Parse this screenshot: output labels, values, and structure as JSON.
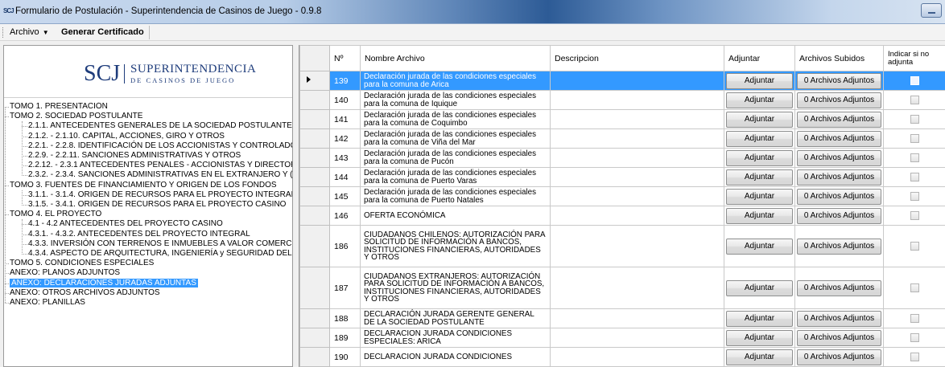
{
  "window": {
    "icon_text": "SCJ",
    "title": "Formulario de Postulación - Superintendencia de Casinos de Juego - 0.9.8"
  },
  "menu": {
    "archivo": "Archivo",
    "generar": "Generar Certificado"
  },
  "logo": {
    "mark": "SCJ",
    "line1": "SUPERINTENDENCIA",
    "line2": "DE CASINOS DE JUEGO"
  },
  "tree": [
    {
      "label": "TOMO 1.  PRESENTACIÓN",
      "level": 0,
      "selected": false
    },
    {
      "label": "TOMO 2.  SOCIEDAD POSTULANTE",
      "level": 0,
      "selected": false
    },
    {
      "label": "2.1.1. ANTECEDENTES GENERALES DE LA SOCIEDAD POSTULANTE",
      "level": 1,
      "selected": false
    },
    {
      "label": "2.1.2. - 2.1.10. CAPITAL, ACCIONES, GIRO Y OTROS",
      "level": 1,
      "selected": false
    },
    {
      "label": "2.2.1. - 2.2.8. IDENTIFICACIÓN DE LOS ACCIONISTAS Y CONTROLADO",
      "level": 1,
      "selected": false
    },
    {
      "label": "2.2.9. - 2.2.11. SANCIONES ADMINISTRATIVAS Y OTROS",
      "level": 1,
      "selected": false
    },
    {
      "label": "2.2.12. - 2.3.1 ANTECEDENTES PENALES - ACCIONISTAS Y DIRECTOR",
      "level": 1,
      "selected": false
    },
    {
      "label": "2.3.2. - 2.3.4. SANCIONES ADMINISTRATIVAS EN EL EXTRANJERO Y (",
      "level": 1,
      "selected": false
    },
    {
      "label": "TOMO 3.  FUENTES DE FINANCIAMIENTO Y ORIGEN DE LOS FONDOS",
      "level": 0,
      "selected": false
    },
    {
      "label": "3.1.1. - 3.1.4. ORIGEN DE RECURSOS PARA EL PROYECTO INTEGRAL",
      "level": 1,
      "selected": false
    },
    {
      "label": "3.1.5. - 3.4.1. ORIGEN DE RECURSOS PARA EL PROYECTO CASINO",
      "level": 1,
      "selected": false
    },
    {
      "label": "TOMO 4.  EL PROYECTO",
      "level": 0,
      "selected": false
    },
    {
      "label": "4.1 - 4.2  ANTECEDENTES DEL PROYECTO CASINO",
      "level": 1,
      "selected": false
    },
    {
      "label": "4.3.1. - 4.3.2. ANTECEDENTES DEL PROYECTO INTEGRAL",
      "level": 1,
      "selected": false
    },
    {
      "label": "4.3.3. INVERSIÓN CON TERRENOS E INMUEBLES A VALOR COMERCI",
      "level": 1,
      "selected": false
    },
    {
      "label": "4.3.4. ASPECTO DE ARQUITECTURA, INGENIERÍA y SEGURIDAD DEL",
      "level": 1,
      "selected": false
    },
    {
      "label": "TOMO 5.  CONDICIONES ESPECIALES",
      "level": 0,
      "selected": false
    },
    {
      "label": "ANEXO: PLANOS ADJUNTOS",
      "level": 0,
      "selected": false
    },
    {
      "label": "ANEXO: DECLARACIONES JURADAS ADJUNTAS",
      "level": 0,
      "selected": true
    },
    {
      "label": "ANEXO: OTROS ARCHIVOS ADJUNTOS",
      "level": 0,
      "selected": false
    },
    {
      "label": "ANEXO: PLANILLAS",
      "level": 0,
      "selected": false
    }
  ],
  "grid": {
    "headers": {
      "num": "Nº",
      "name": "Nombre Archivo",
      "desc": "Descripcion",
      "adjuntar": "Adjuntar",
      "subidos": "Archivos Subidos",
      "indicar": "Indicar si no adjunta"
    },
    "button_label": "Adjuntar",
    "rows": [
      {
        "num": "139",
        "name": "Declaración jurada de las condiciones especiales para la comuna de Arica",
        "desc": "",
        "files": "0 Archivos Adjuntos",
        "selected": true
      },
      {
        "num": "140",
        "name": "Declaración jurada de las condiciones especiales para la comuna de Iquique",
        "desc": "",
        "files": "0 Archivos Adjuntos",
        "selected": false
      },
      {
        "num": "141",
        "name": "Declaración jurada de las condiciones especiales para la comuna de Coquimbo",
        "desc": "",
        "files": "0 Archivos Adjuntos",
        "selected": false
      },
      {
        "num": "142",
        "name": "Declaración jurada de las condiciones especiales para la comuna de Viña del Mar",
        "desc": "",
        "files": "0 Archivos Adjuntos",
        "selected": false
      },
      {
        "num": "143",
        "name": "Declaración jurada de las condiciones especiales para la comuna de Pucón",
        "desc": "",
        "files": "0 Archivos Adjuntos",
        "selected": false
      },
      {
        "num": "144",
        "name": "Declaración jurada de las condiciones especiales para la comuna de Puerto Varas",
        "desc": "",
        "files": "0 Archivos Adjuntos",
        "selected": false
      },
      {
        "num": "145",
        "name": "Declaración jurada de las condiciones especiales para la comuna de Puerto Natales",
        "desc": "",
        "files": "0 Archivos Adjuntos",
        "selected": false
      },
      {
        "num": "146",
        "name": "OFERTA ECONÓMICA",
        "desc": "",
        "files": "0 Archivos Adjuntos",
        "selected": false
      },
      {
        "num": "186",
        "name": "CIUDADANOS CHILENOS: AUTORIZACIÓN PARA SOLICITUD DE INFORMACIÓN A BANCOS, INSTITUCIONES FINANCIERAS, AUTORIDADES Y OTROS",
        "desc": "",
        "files": "0 Archivos Adjuntos",
        "selected": false
      },
      {
        "num": "187",
        "name": "CIUDADANOS EXTRANJEROS: AUTORIZACIÓN PARA SOLICITUD DE INFORMACIÓN A BANCOS, INSTITUCIONES FINANCIERAS, AUTORIDADES Y OTROS",
        "desc": "",
        "files": "0 Archivos Adjuntos",
        "selected": false
      },
      {
        "num": "188",
        "name": "DECLARACIÓN JURADA GERENTE GENERAL DE LA SOCIEDAD POSTULANTE",
        "desc": "",
        "files": "0 Archivos Adjuntos",
        "selected": false
      },
      {
        "num": "189",
        "name": "DECLARACION JURADA CONDICIONES ESPECIALES: ARICA",
        "desc": "",
        "files": "0 Archivos Adjuntos",
        "selected": false
      },
      {
        "num": "190",
        "name": "DECLARACION JURADA CONDICIONES",
        "desc": "",
        "files": "0 Archivos Adjuntos",
        "selected": false
      }
    ]
  }
}
